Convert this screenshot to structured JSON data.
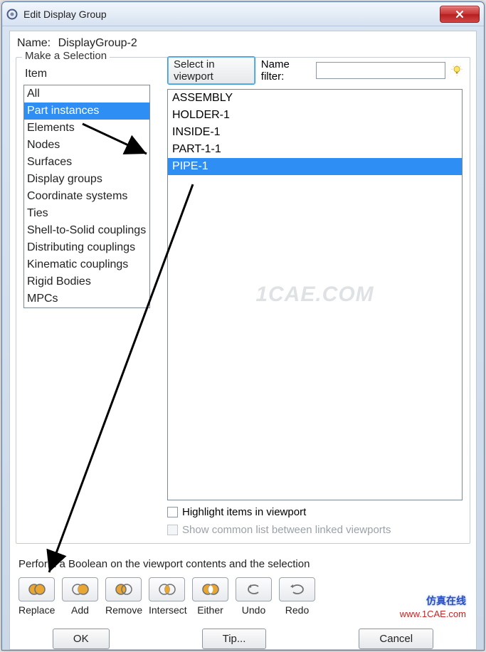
{
  "titlebar": {
    "title": "Edit Display Group"
  },
  "nameRow": {
    "label": "Name:",
    "value": "DisplayGroup-2"
  },
  "fieldset": {
    "legend": "Make a Selection",
    "itemHeader": "Item",
    "viewportBtn": "Select in viewport",
    "filterLabel": "Name filter:",
    "filterValue": ""
  },
  "itemList": [
    {
      "label": "All",
      "selected": false
    },
    {
      "label": "Part instances",
      "selected": true
    },
    {
      "label": "Elements",
      "selected": false
    },
    {
      "label": "Nodes",
      "selected": false
    },
    {
      "label": "Surfaces",
      "selected": false
    },
    {
      "label": "Display groups",
      "selected": false
    },
    {
      "label": "Coordinate systems",
      "selected": false
    },
    {
      "label": "Ties",
      "selected": false
    },
    {
      "label": "Shell-to-Solid couplings",
      "selected": false
    },
    {
      "label": "Distributing couplings",
      "selected": false
    },
    {
      "label": "Kinematic couplings",
      "selected": false
    },
    {
      "label": "Rigid Bodies",
      "selected": false
    },
    {
      "label": "MPCs",
      "selected": false
    }
  ],
  "rightList": [
    {
      "label": "ASSEMBLY",
      "selected": false
    },
    {
      "label": "HOLDER-1",
      "selected": false
    },
    {
      "label": "INSIDE-1",
      "selected": false
    },
    {
      "label": "PART-1-1",
      "selected": false
    },
    {
      "label": "PIPE-1",
      "selected": true
    }
  ],
  "watermark": "1CAE.COM",
  "chk1": "Highlight items in viewport",
  "chk2": "Show common list between linked viewports",
  "boolLabel": "Perform a Boolean on the viewport contents and the selection",
  "boolBtns": [
    "Replace",
    "Add",
    "Remove",
    "Intersect",
    "Either",
    "Undo",
    "Redo"
  ],
  "dlg": {
    "ok": "OK",
    "tip": "Tip...",
    "cancel": "Cancel"
  },
  "ext": {
    "cn": "仿真在线",
    "url": "www.1CAE.com"
  }
}
